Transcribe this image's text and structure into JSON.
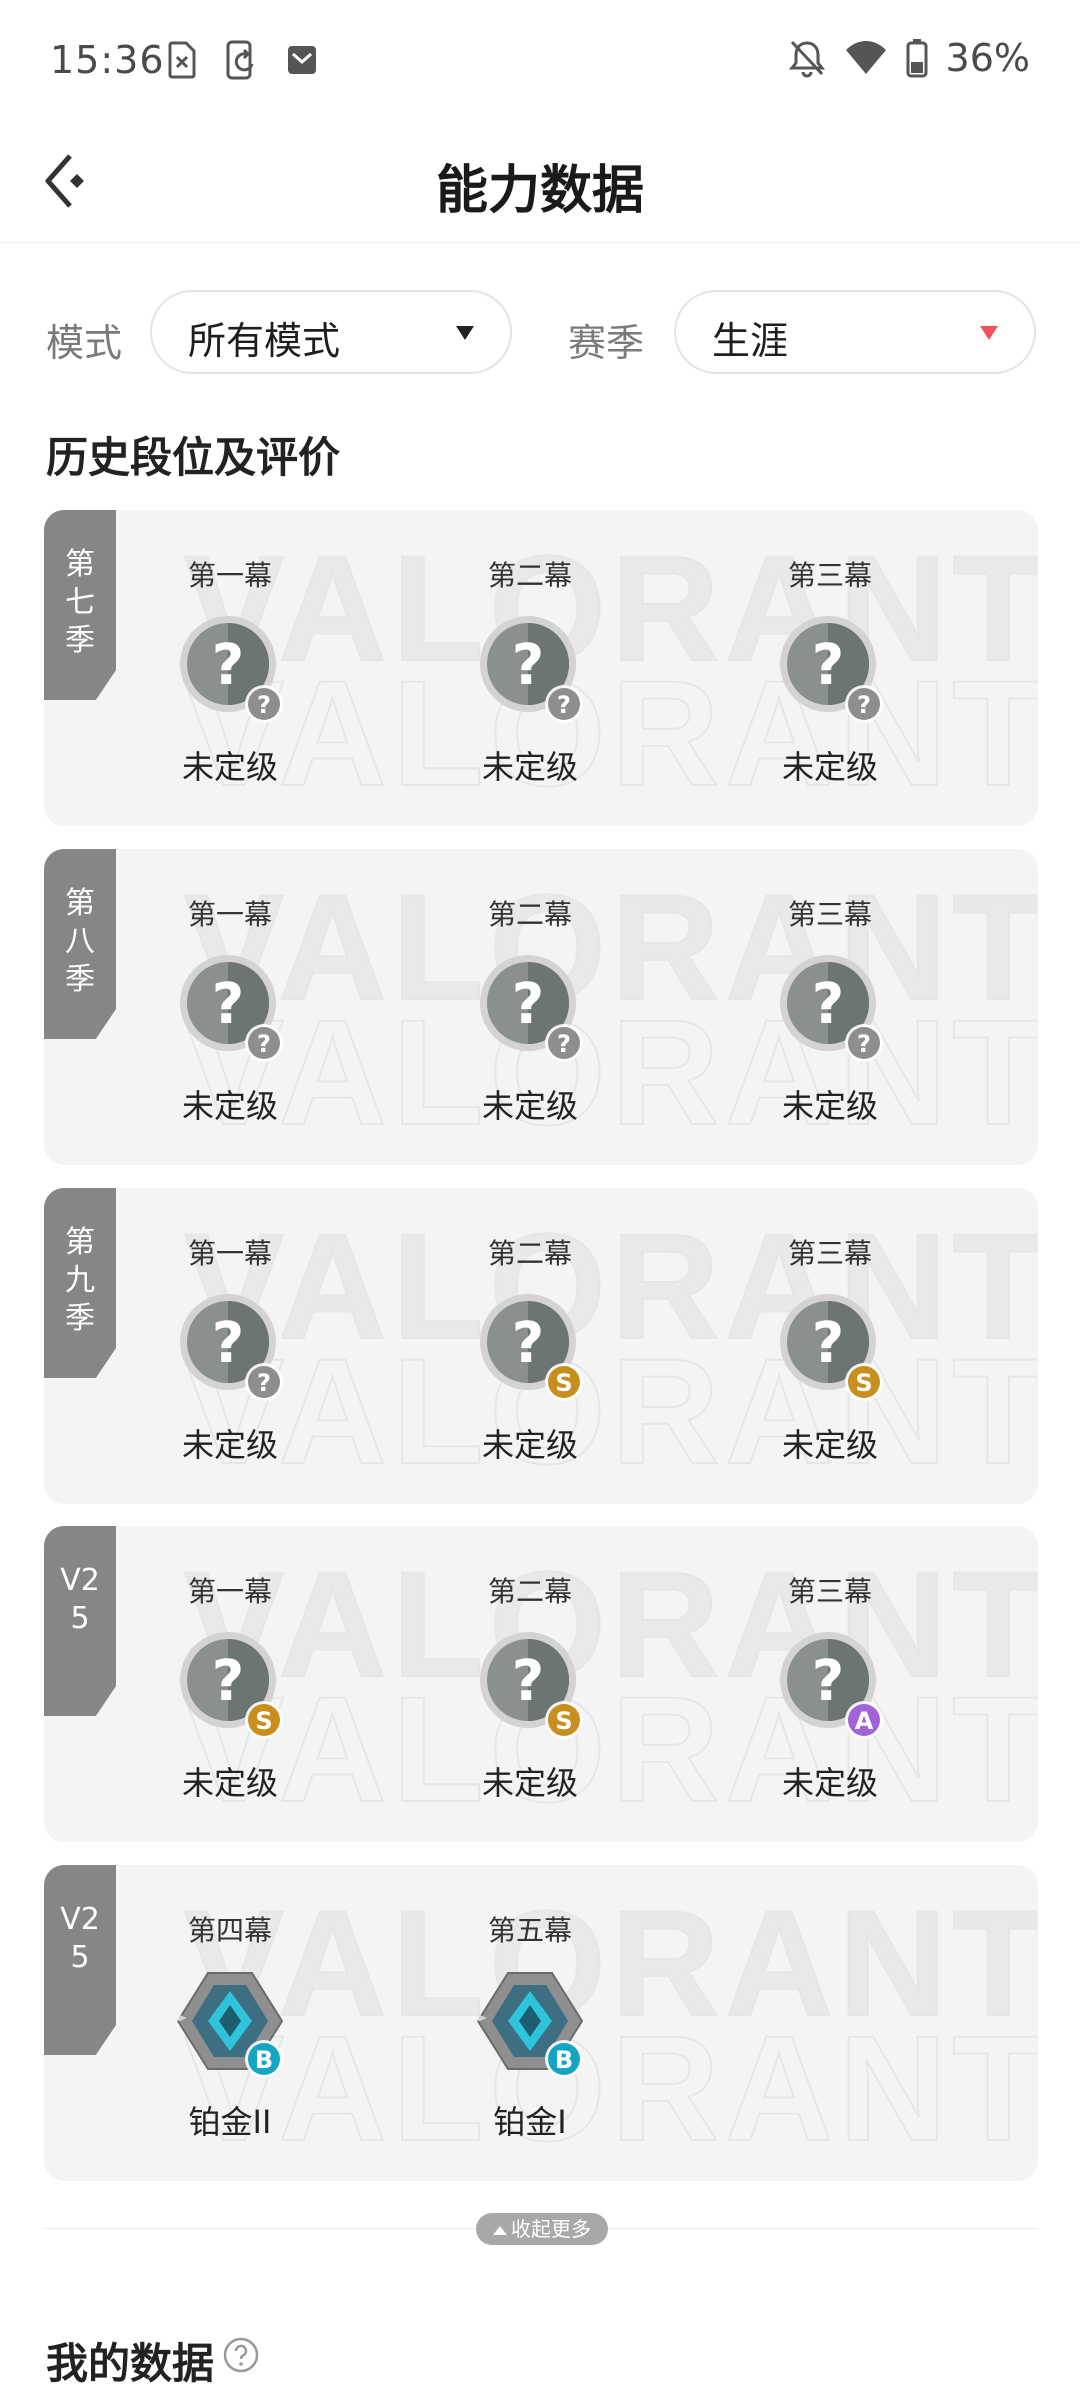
{
  "status_bar": {
    "time": "15:36",
    "icons_left": [
      "sim-error-icon",
      "phone-sync-icon",
      "mail-icon"
    ],
    "icons_right": [
      "bell-off-icon",
      "wifi-icon",
      "battery-icon"
    ],
    "battery": "36%"
  },
  "header": {
    "title": "能力数据",
    "back_icon": "back-arrow-icon"
  },
  "filters": {
    "mode_label": "模式",
    "mode_value": "所有模式",
    "season_label": "赛季",
    "season_value": "生涯"
  },
  "section_title": "历史段位及评价",
  "watermark_text": "VALORANT",
  "seasons": [
    {
      "tag": "第\n七\n季",
      "acts": [
        {
          "label": "第一幕",
          "rank": "未定级",
          "emblem": "unrated",
          "grade": "?"
        },
        {
          "label": "第二幕",
          "rank": "未定级",
          "emblem": "unrated",
          "grade": "?"
        },
        {
          "label": "第三幕",
          "rank": "未定级",
          "emblem": "unrated",
          "grade": "?"
        }
      ]
    },
    {
      "tag": "第\n八\n季",
      "acts": [
        {
          "label": "第一幕",
          "rank": "未定级",
          "emblem": "unrated",
          "grade": "?"
        },
        {
          "label": "第二幕",
          "rank": "未定级",
          "emblem": "unrated",
          "grade": "?"
        },
        {
          "label": "第三幕",
          "rank": "未定级",
          "emblem": "unrated",
          "grade": "?"
        }
      ]
    },
    {
      "tag": "第\n九\n季",
      "acts": [
        {
          "label": "第一幕",
          "rank": "未定级",
          "emblem": "unrated",
          "grade": "?"
        },
        {
          "label": "第二幕",
          "rank": "未定级",
          "emblem": "unrated",
          "grade": "S"
        },
        {
          "label": "第三幕",
          "rank": "未定级",
          "emblem": "unrated",
          "grade": "S"
        }
      ]
    },
    {
      "tag": "V2\n5",
      "acts": [
        {
          "label": "第一幕",
          "rank": "未定级",
          "emblem": "unrated",
          "grade": "S"
        },
        {
          "label": "第二幕",
          "rank": "未定级",
          "emblem": "unrated",
          "grade": "S"
        },
        {
          "label": "第三幕",
          "rank": "未定级",
          "emblem": "unrated",
          "grade": "A"
        }
      ]
    },
    {
      "tag": "V2\n5",
      "acts": [
        {
          "label": "第四幕",
          "rank": "铂金II",
          "emblem": "platinum",
          "grade": "B"
        },
        {
          "label": "第五幕",
          "rank": "铂金I",
          "emblem": "platinum",
          "grade": "B"
        }
      ]
    }
  ],
  "grade_colors": {
    "?": "#8e8e8e",
    "S": "#c98f1e",
    "A": "#a064d8",
    "B": "#14a5c0"
  },
  "collapse_label": "收起更多",
  "my_data_title": "我的数据",
  "help_icon": "help-circle-icon"
}
